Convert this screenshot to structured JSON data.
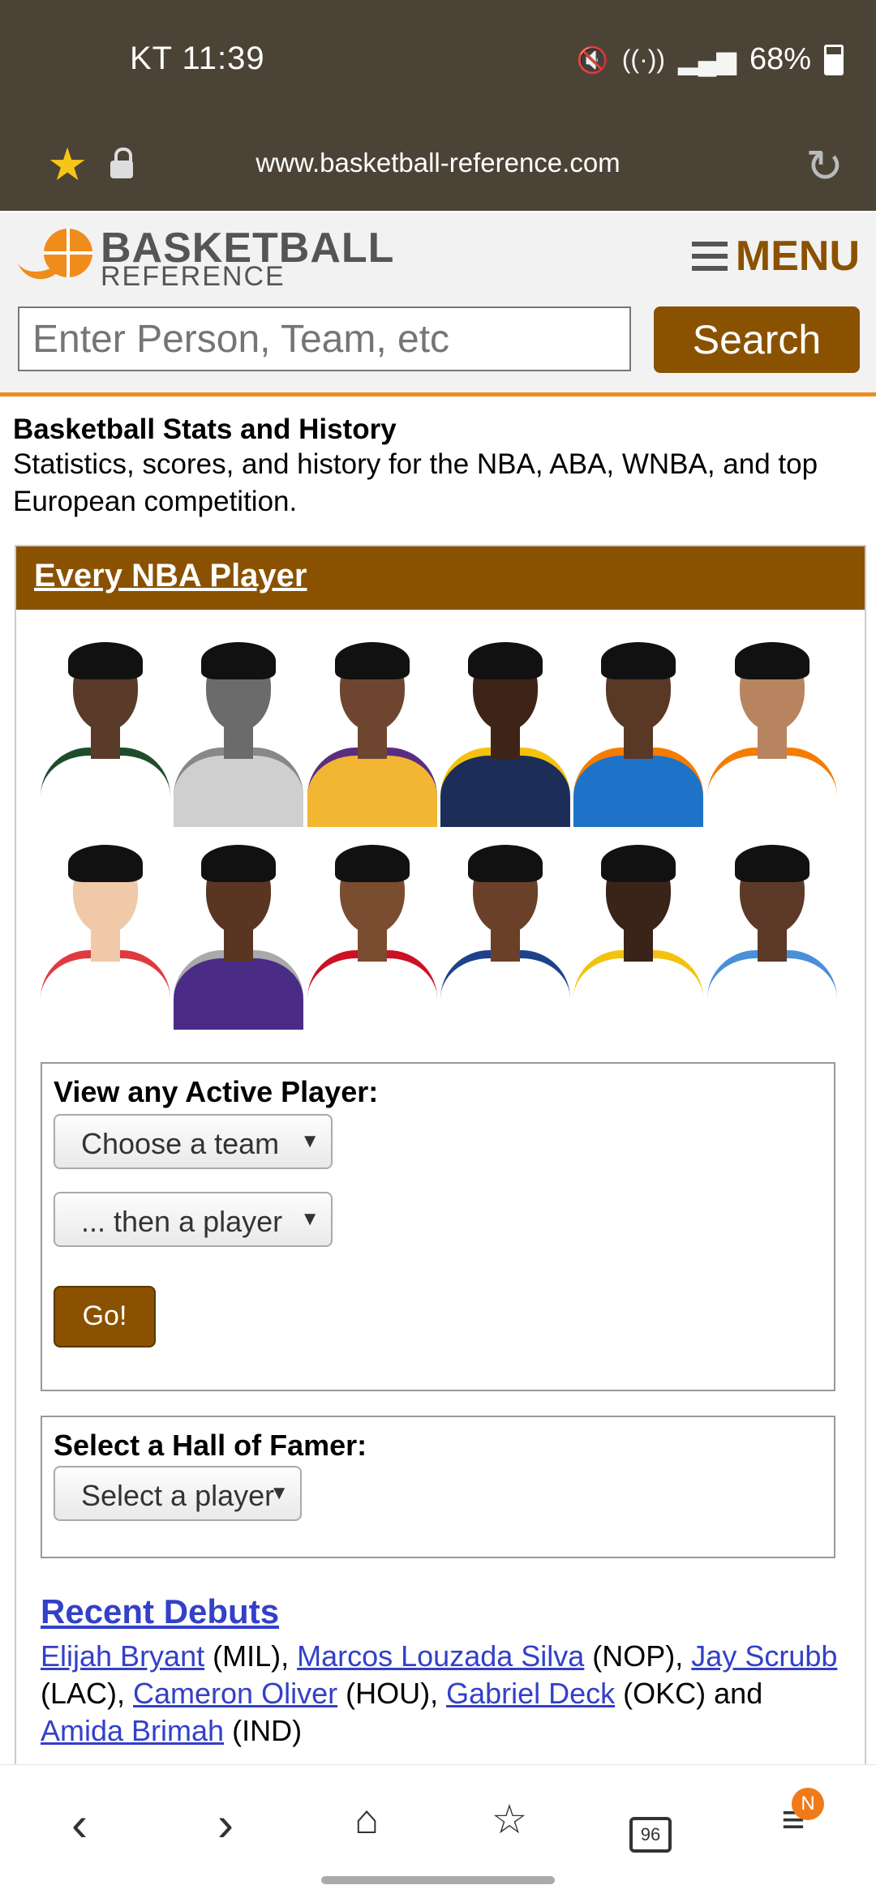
{
  "status": {
    "carrier_time": "KT 11:39",
    "battery": "68%"
  },
  "browser": {
    "url": "www.basketball-reference.com"
  },
  "header": {
    "logo_title": "BASKETBALL",
    "logo_sub": "REFERENCE",
    "menu_label": "MENU",
    "search_placeholder": "Enter Person, Team, etc",
    "search_button": "Search"
  },
  "intro": {
    "title": "Basketball Stats and History",
    "text": "Statistics, scores, and history for the NBA, ABA, WNBA, and top European competition."
  },
  "players_section": {
    "heading": "Every NBA Player",
    "faces": [
      {
        "skin": "#5a3b2a",
        "jersey": "#ffffff",
        "trim": "#1e4d2b"
      },
      {
        "skin": "#6b6b6b",
        "jersey": "#cfcfcf",
        "trim": "#888888"
      },
      {
        "skin": "#6e4630",
        "jersey": "#f2b632",
        "trim": "#5a2d82"
      },
      {
        "skin": "#3d2417",
        "jersey": "#1c2d57",
        "trim": "#f4c20d"
      },
      {
        "skin": "#5a3826",
        "jersey": "#1e73c8",
        "trim": "#f57c00"
      },
      {
        "skin": "#b88460",
        "jersey": "#ffffff",
        "trim": "#f57c00"
      },
      {
        "skin": "#f0c9a8",
        "jersey": "#ffffff",
        "trim": "#e03a3e"
      },
      {
        "skin": "#5a3622",
        "jersey": "#4a2b86",
        "trim": "#a9a9a9"
      },
      {
        "skin": "#7a4c30",
        "jersey": "#ffffff",
        "trim": "#cc1122"
      },
      {
        "skin": "#6a4028",
        "jersey": "#ffffff",
        "trim": "#1d428a"
      },
      {
        "skin": "#3a2318",
        "jersey": "#ffffff",
        "trim": "#f4c20d"
      },
      {
        "skin": "#5c3a27",
        "jersey": "#ffffff",
        "trim": "#4a90d9"
      }
    ]
  },
  "active_player": {
    "label": "View any Active Player:",
    "team_select": "Choose a team",
    "player_select": "... then a player",
    "go_button": "Go!"
  },
  "hall_of_fame": {
    "label": "Select a Hall of Famer:",
    "select": "Select a player"
  },
  "recent_debuts": {
    "title": "Recent Debuts",
    "entries": [
      {
        "name": "Elijah Bryant",
        "after": " (MIL), "
      },
      {
        "name": "Marcos Louzada Silva",
        "after": " (NOP), "
      },
      {
        "name": "Jay Scrubb",
        "after": " (LAC), "
      },
      {
        "name": "Cameron Oliver",
        "after": " (HOU), "
      },
      {
        "name": "Gabriel Deck",
        "after": " (OKC) and "
      },
      {
        "name": "Amida Brimah",
        "after": " (IND)"
      }
    ]
  },
  "bottom_nav": {
    "tabs_count": "96",
    "badge": "N"
  },
  "colors": {
    "brand_brown": "#8a5200",
    "accent_orange": "#f08c1c",
    "link_blue": "#3340c8"
  }
}
